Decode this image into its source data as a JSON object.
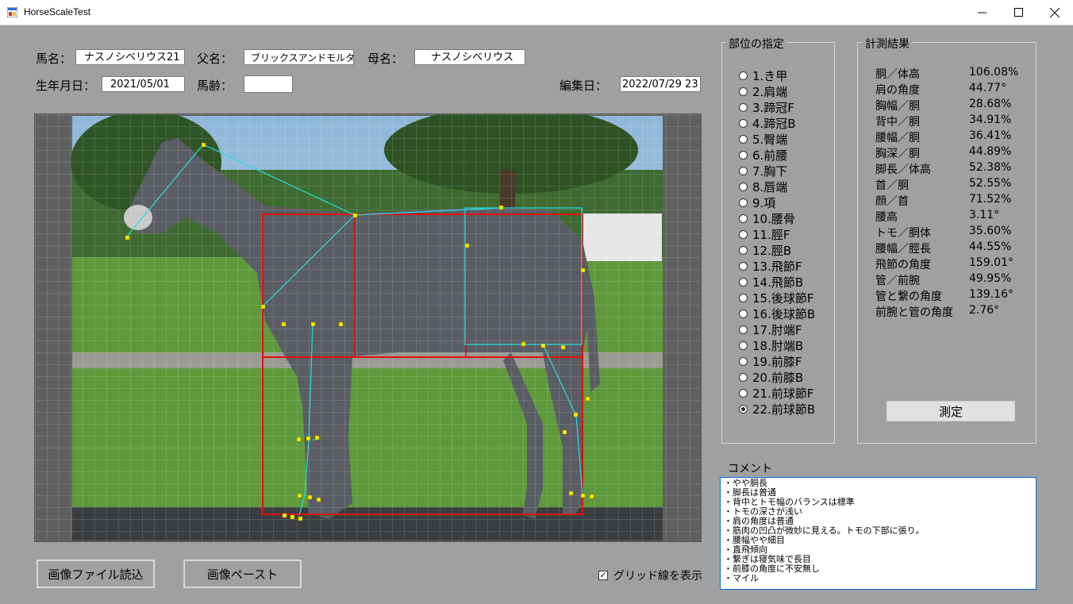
{
  "window": {
    "title": "HorseScaleTest"
  },
  "form": {
    "horse_name_label": "馬名：",
    "horse_name": "ナスノシベリウス21",
    "sire_label": "父名：",
    "sire": "ブリックスアンドモルタル",
    "dam_label": "母名：",
    "dam": "ナスノシベリウス",
    "birth_label": "生年月日：",
    "birth": "2021/05/01",
    "age_label": "馬齢：",
    "age": "",
    "edit_label": "編集日：",
    "edit_date": "2022/07/29 23"
  },
  "parts": {
    "title": "部位の指定",
    "selected_index": 21,
    "items": [
      "1.き甲",
      "2.肩端",
      "3.蹄冠F",
      "4.蹄冠B",
      "5.臀端",
      "6.前腰",
      "7.胸下",
      "8.唇端",
      "9.項",
      "10.腰骨",
      "11.脛F",
      "12.脛B",
      "13.飛節F",
      "14.飛節B",
      "15.後球節F",
      "16.後球節B",
      "17.肘端F",
      "18.肘端B",
      "19.前膝F",
      "20.前膝B",
      "21.前球節F",
      "22.前球節B"
    ]
  },
  "results": {
    "title": "計測結果",
    "rows": [
      {
        "name": "胴／体高",
        "value": "106.08%"
      },
      {
        "name": "肩の角度",
        "value": "44.77°"
      },
      {
        "name": "胸幅／胴",
        "value": "28.68%"
      },
      {
        "name": "背中／胴",
        "value": "34.91%"
      },
      {
        "name": "腰幅／胴",
        "value": "36.41%"
      },
      {
        "name": "胸深／胴",
        "value": "44.89%"
      },
      {
        "name": "脚長／体高",
        "value": "52.38%"
      },
      {
        "name": "首／胴",
        "value": "52.55%"
      },
      {
        "name": "顔／首",
        "value": "71.52%"
      },
      {
        "name": "腰高",
        "value": "3.11°"
      },
      {
        "name": "トモ／胴体",
        "value": "35.60%"
      },
      {
        "name": "腰幅／脛長",
        "value": "44.55%"
      },
      {
        "name": "飛節の角度",
        "value": "159.01°"
      },
      {
        "name": "管／前腕",
        "value": "49.95%"
      },
      {
        "name": "管と繋の角度",
        "value": "139.16°"
      },
      {
        "name": "前腕と管の角度",
        "value": "2.76°"
      }
    ],
    "measure_button": "測定"
  },
  "comment": {
    "label": "コメント",
    "lines": [
      "・やや胴長",
      "・脚長は普通",
      "・背中とトモ幅のバランスは標準",
      "・トモの深さが浅い",
      "・肩の角度は普通",
      "・筋肉の凹凸が微妙に見える。トモの下部に張り。",
      "・腰幅やや細目",
      "・直飛傾向",
      "・繋ぎは寝気味で長目",
      "・前膝の角度に不安無し",
      "・マイル"
    ]
  },
  "buttons": {
    "load_image": "画像ファイル読込",
    "paste_image": "画像ペースト"
  },
  "grid_checkbox": {
    "label": "グリッド線を表示",
    "checked": true
  },
  "icons": {
    "app": "app-icon",
    "minimize": "minimize-icon",
    "maximize": "maximize-icon",
    "close": "close-icon"
  },
  "colors": {
    "frame_red": "#e01010",
    "line_cyan": "#22e0e0",
    "point_yellow": "#ffee00",
    "grid": "#ffffff"
  }
}
